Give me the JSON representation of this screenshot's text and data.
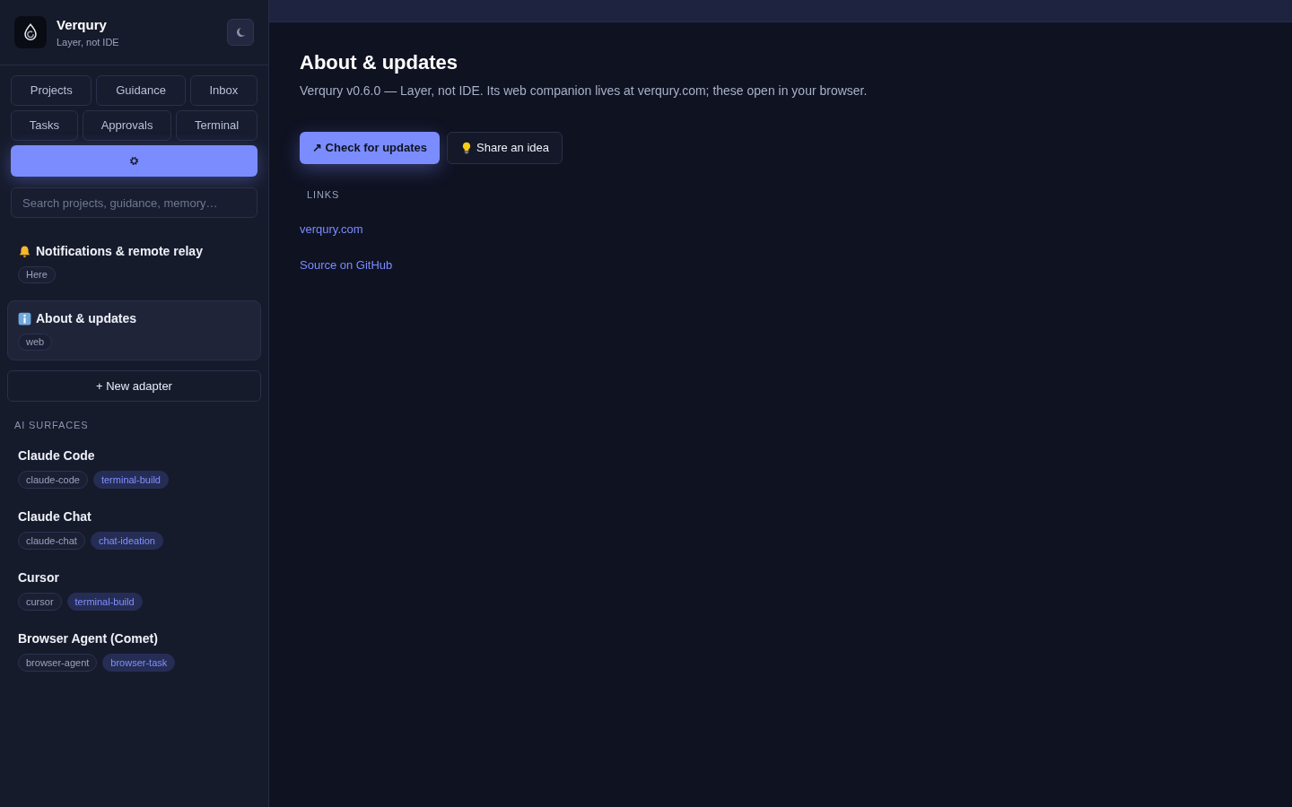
{
  "sidebar": {
    "brand": {
      "name": "Verqury",
      "tagline": "Layer, not IDE"
    },
    "nav_rows": [
      [
        {
          "kind": "text",
          "label": "Projects",
          "selected": false
        },
        {
          "kind": "text",
          "label": "Guidance",
          "selected": false
        },
        {
          "kind": "text",
          "label": "Inbox",
          "selected": false
        }
      ],
      [
        {
          "kind": "text",
          "label": "Tasks",
          "selected": false
        },
        {
          "kind": "text",
          "label": "Approvals",
          "selected": false
        },
        {
          "kind": "text",
          "label": "Terminal",
          "selected": false
        }
      ],
      [
        {
          "kind": "settings",
          "selected": true
        }
      ]
    ],
    "search": {
      "placeholder": "Search projects, guidance, memory…"
    },
    "adapters": [
      {
        "kind": "bell",
        "title": "Notifications & remote relay",
        "tag": "Here",
        "selected": false
      },
      {
        "kind": "info",
        "title": "About & updates",
        "tag": "web",
        "selected": true
      }
    ],
    "new_adapter_button": "+ New adapter",
    "section_heading": "AI SURFACES",
    "surfaces": [
      {
        "name": "Claude Code",
        "tags": [
          {
            "kind": "id",
            "label": "claude-code"
          },
          {
            "kind": "mode",
            "label": "terminal-build"
          }
        ]
      },
      {
        "name": "Claude Chat",
        "tags": [
          {
            "kind": "id",
            "label": "claude-chat"
          },
          {
            "kind": "mode",
            "label": "chat-ideation"
          }
        ]
      },
      {
        "name": "Cursor",
        "tags": [
          {
            "kind": "id",
            "label": "cursor"
          },
          {
            "kind": "mode",
            "label": "terminal-build"
          }
        ]
      },
      {
        "name": "Browser Agent (Comet)",
        "tags": [
          {
            "kind": "id",
            "label": "browser-agent"
          },
          {
            "kind": "mode",
            "label": "browser-task"
          }
        ]
      }
    ]
  },
  "main": {
    "title": "About & updates",
    "description": "Verqury v0.6.0 — Layer, not IDE. Its web companion lives at verqury.com; these open in your browser.",
    "buttons": [
      {
        "kind": "primary",
        "label": "↗ Check for updates"
      },
      {
        "kind": "idea",
        "label": "Share an idea"
      }
    ],
    "links_heading": "LINKS",
    "links": [
      "verqury.com",
      "Source on GitHub"
    ]
  }
}
